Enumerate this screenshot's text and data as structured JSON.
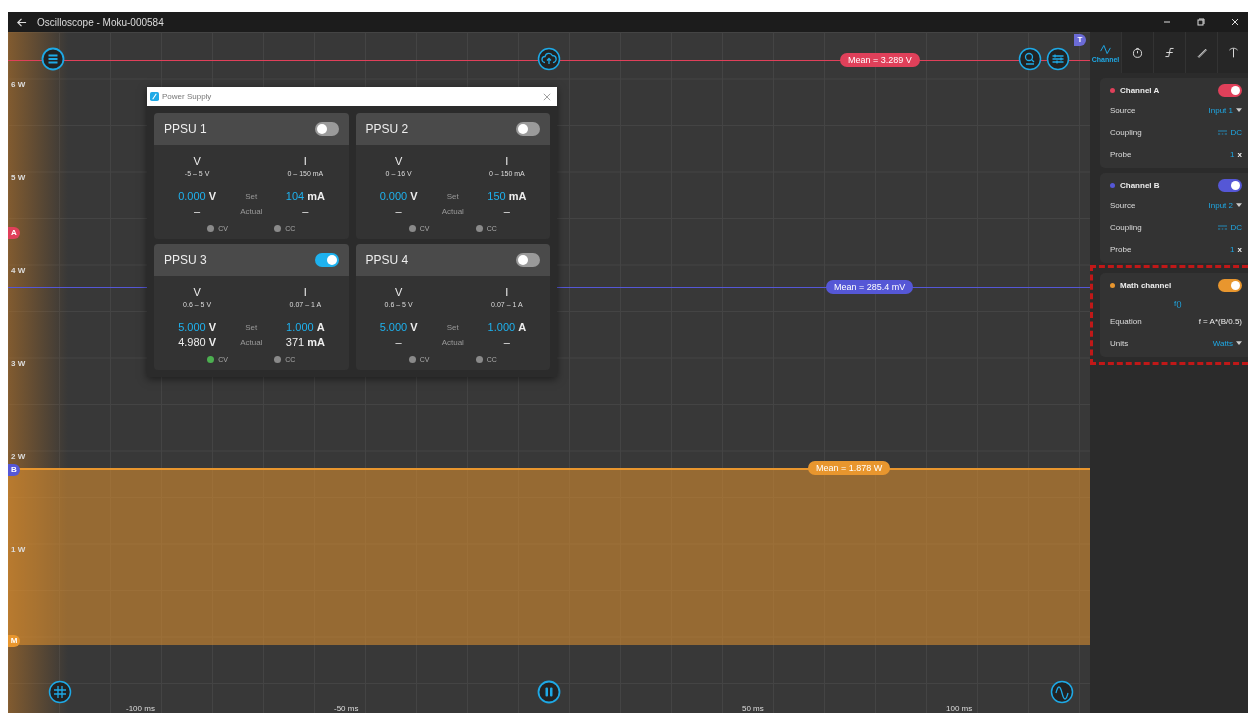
{
  "window": {
    "title": "Oscilloscope - Moku-000584"
  },
  "plot": {
    "y_labels": [
      "6 W",
      "5 W",
      "4 W",
      "3 W",
      "2 W",
      "1 W"
    ],
    "x_labels": [
      "-100 ms",
      "-50 ms",
      "50 ms",
      "100 ms"
    ],
    "traces": [
      {
        "kind": "line",
        "label": "Mean = 3.289 V",
        "color": "#e0405a"
      },
      {
        "kind": "line",
        "label": "Mean = 285.4 mV",
        "color": "#5557d6"
      },
      {
        "kind": "filled",
        "label": "Mean = 1.878 W",
        "color": "#e8962e"
      }
    ],
    "markers": [
      {
        "label": "A",
        "color": "#e0405a"
      },
      {
        "label": "B",
        "color": "#5557d6"
      },
      {
        "label": "M",
        "color": "#e8962e"
      },
      {
        "label": "T",
        "color": "#6b6bd6"
      }
    ]
  },
  "power_supply": {
    "title": "Power Supply",
    "channels": [
      {
        "name": "PPSU 1",
        "on": false,
        "v_label": "V",
        "i_label": "I",
        "v_range": "-5 – 5 V",
        "i_range": "0 – 150 mA",
        "set_label": "Set",
        "actual_label": "Actual",
        "set_v": {
          "value": "0.000",
          "unit": "V"
        },
        "set_i": {
          "value": "104",
          "unit": "mA"
        },
        "actual_v": {
          "value": "–"
        },
        "actual_i": {
          "value": "–"
        },
        "cv": {
          "label": "CV",
          "active": false
        },
        "cc": {
          "label": "CC",
          "active": false
        }
      },
      {
        "name": "PPSU 2",
        "on": false,
        "v_label": "V",
        "i_label": "I",
        "v_range": "0 – 16 V",
        "i_range": "0 – 150 mA",
        "set_label": "Set",
        "actual_label": "Actual",
        "set_v": {
          "value": "0.000",
          "unit": "V"
        },
        "set_i": {
          "value": "150",
          "unit": "mA"
        },
        "actual_v": {
          "value": "–"
        },
        "actual_i": {
          "value": "–"
        },
        "cv": {
          "label": "CV",
          "active": false
        },
        "cc": {
          "label": "CC",
          "active": false
        }
      },
      {
        "name": "PPSU 3",
        "on": true,
        "v_label": "V",
        "i_label": "I",
        "v_range": "0.6 – 5 V",
        "i_range": "0.07 – 1 A",
        "set_label": "Set",
        "actual_label": "Actual",
        "set_v": {
          "value": "5.000",
          "unit": "V"
        },
        "set_i": {
          "value": "1.000",
          "unit": "A"
        },
        "actual_v": {
          "value": "4.980",
          "unit": "V"
        },
        "actual_i": {
          "value": "371",
          "unit": "mA"
        },
        "cv": {
          "label": "CV",
          "active": true
        },
        "cc": {
          "label": "CC",
          "active": false
        }
      },
      {
        "name": "PPSU 4",
        "on": false,
        "v_label": "V",
        "i_label": "I",
        "v_range": "0.6 – 5 V",
        "i_range": "0.07 – 1 A",
        "set_label": "Set",
        "actual_label": "Actual",
        "set_v": {
          "value": "5.000",
          "unit": "V"
        },
        "set_i": {
          "value": "1.000",
          "unit": "A"
        },
        "actual_v": {
          "value": "–"
        },
        "actual_i": {
          "value": "–"
        },
        "cv": {
          "label": "CV",
          "active": false
        },
        "cc": {
          "label": "CC",
          "active": false
        }
      }
    ]
  },
  "sidebar": {
    "tabs": [
      {
        "kind": "wave",
        "label": "Channel",
        "selected": true
      },
      {
        "kind": "timer",
        "selected": false
      },
      {
        "kind": "trigger",
        "selected": false
      },
      {
        "kind": "ruler",
        "selected": false
      },
      {
        "kind": "cursor",
        "selected": false
      }
    ],
    "channels": [
      {
        "name": "Channel A",
        "color": "#e0405a",
        "on": true,
        "highlighted": false,
        "rows": [
          {
            "kind": "dropdown",
            "label": "Source",
            "value": "Input 1"
          },
          {
            "kind": "coupling",
            "label": "Coupling",
            "value": "DC"
          },
          {
            "kind": "probe",
            "label": "Probe",
            "value": "1",
            "unit": "x"
          }
        ]
      },
      {
        "name": "Channel B",
        "color": "#5557d6",
        "on": true,
        "highlighted": false,
        "rows": [
          {
            "kind": "dropdown",
            "label": "Source",
            "value": "Input 2"
          },
          {
            "kind": "coupling",
            "label": "Coupling",
            "value": "DC"
          },
          {
            "kind": "probe",
            "label": "Probe",
            "value": "1",
            "unit": "x"
          }
        ]
      },
      {
        "name": "Math channel",
        "color": "#e8962e",
        "on": true,
        "highlighted": true,
        "subtitle": "f()",
        "rows": [
          {
            "kind": "text",
            "label": "Equation",
            "value": "f = A*(B/0.5)"
          },
          {
            "kind": "dropdown",
            "label": "Units",
            "value": "Watts"
          }
        ]
      }
    ]
  }
}
